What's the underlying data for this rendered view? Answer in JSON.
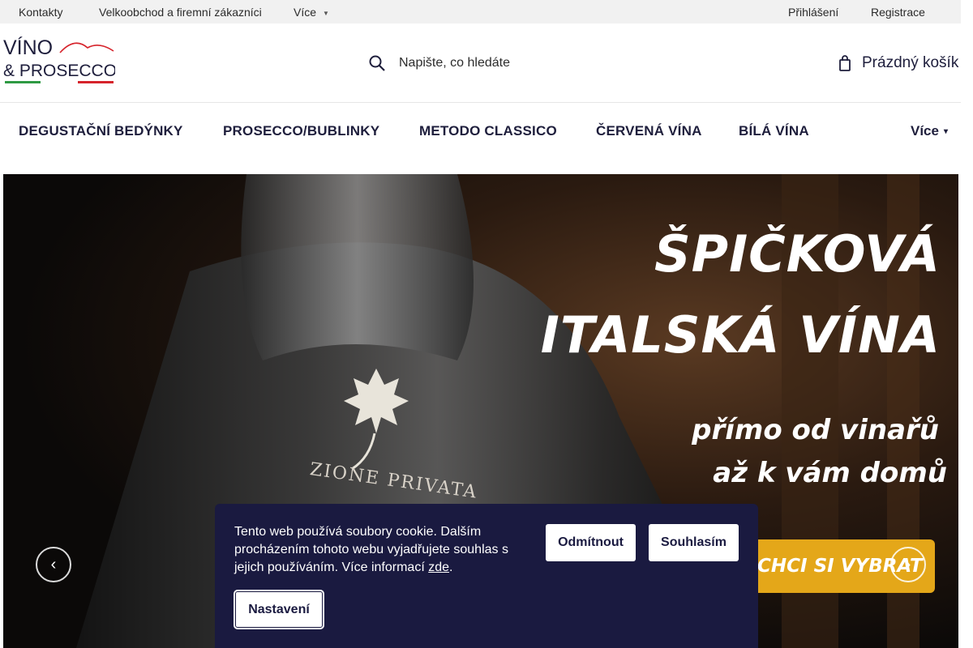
{
  "topbar": {
    "contacts": "Kontakty",
    "wholesale": "Velkoobchod a firemní zákazníci",
    "more": "Více",
    "login": "Přihlášení",
    "register": "Registrace"
  },
  "header": {
    "logo_line1": "VÍNO",
    "logo_line2": "& PROSECCO",
    "search_placeholder": "Napište, co hledáte",
    "cart_label": "Prázdný košík"
  },
  "nav": {
    "items": [
      "DEGUSTAČNÍ BEDÝNKY",
      "PROSECCO/BUBLINKY",
      "METODO CLASSICO",
      "ČERVENÁ VÍNA",
      "BÍLÁ VÍNA"
    ],
    "more": "Více"
  },
  "hero": {
    "line1": "ŠPIČKOVÁ",
    "line2": "ITALSKÁ VÍNA",
    "line3": "přímo od vinařů",
    "line4": "až k vám domů",
    "cta": "CHCI SI VYBRAT",
    "bottle_label": "ZIONE PRIVATA"
  },
  "cookie": {
    "message": "Tento web používá soubory cookie. Dalším procházením tohoto webu vyjadřujete souhlas s jejich používáním. Více informací ",
    "link": "zde",
    "after_link": ".",
    "decline": "Odmítnout",
    "accept": "Souhlasím",
    "settings": "Nastavení"
  },
  "colors": {
    "brand_navy": "#1e1e3c",
    "cookie_bg": "#1a1a40",
    "cta_gold": "#e4a719",
    "logo_green": "#2e9a43",
    "logo_red": "#d6232b"
  }
}
